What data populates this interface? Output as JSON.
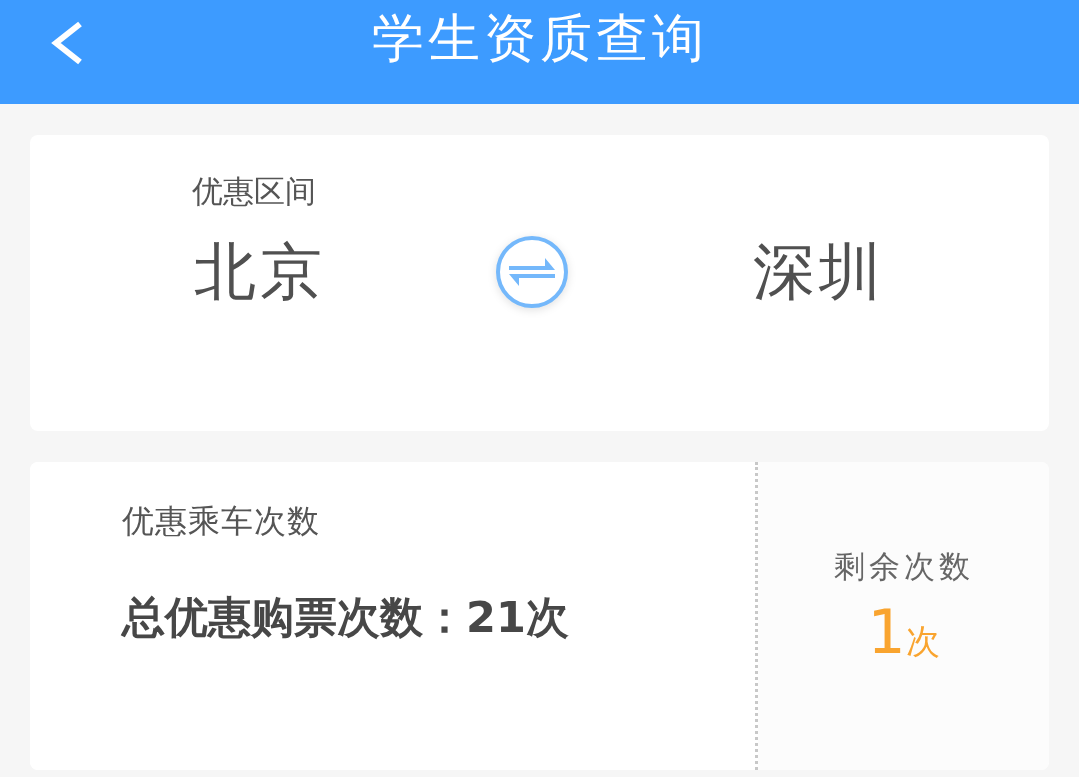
{
  "header": {
    "title": "学生资质查询"
  },
  "route_card": {
    "label": "优惠区间",
    "from": "北京",
    "to": "深圳"
  },
  "count_card": {
    "label": "优惠乘车次数",
    "total": "总优惠购票次数：21次",
    "remaining_label": "剩余次数",
    "remaining": {
      "number": "1",
      "unit": "次"
    }
  }
}
